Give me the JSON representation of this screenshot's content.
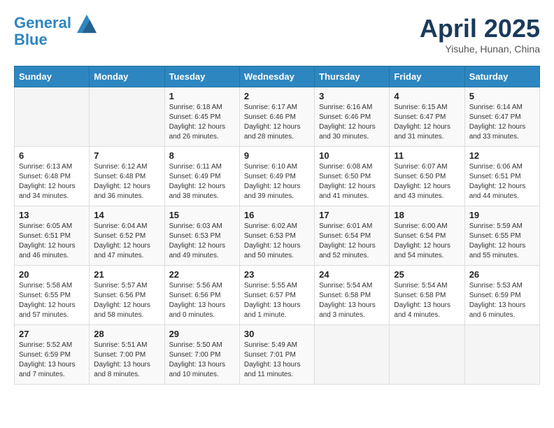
{
  "header": {
    "logo_line1": "General",
    "logo_line2": "Blue",
    "month": "April 2025",
    "location": "Yisuhe, Hunan, China"
  },
  "weekdays": [
    "Sunday",
    "Monday",
    "Tuesday",
    "Wednesday",
    "Thursday",
    "Friday",
    "Saturday"
  ],
  "weeks": [
    [
      {
        "day": "",
        "detail": ""
      },
      {
        "day": "",
        "detail": ""
      },
      {
        "day": "1",
        "detail": "Sunrise: 6:18 AM\nSunset: 6:45 PM\nDaylight: 12 hours and 26 minutes."
      },
      {
        "day": "2",
        "detail": "Sunrise: 6:17 AM\nSunset: 6:46 PM\nDaylight: 12 hours and 28 minutes."
      },
      {
        "day": "3",
        "detail": "Sunrise: 6:16 AM\nSunset: 6:46 PM\nDaylight: 12 hours and 30 minutes."
      },
      {
        "day": "4",
        "detail": "Sunrise: 6:15 AM\nSunset: 6:47 PM\nDaylight: 12 hours and 31 minutes."
      },
      {
        "day": "5",
        "detail": "Sunrise: 6:14 AM\nSunset: 6:47 PM\nDaylight: 12 hours and 33 minutes."
      }
    ],
    [
      {
        "day": "6",
        "detail": "Sunrise: 6:13 AM\nSunset: 6:48 PM\nDaylight: 12 hours and 34 minutes."
      },
      {
        "day": "7",
        "detail": "Sunrise: 6:12 AM\nSunset: 6:48 PM\nDaylight: 12 hours and 36 minutes."
      },
      {
        "day": "8",
        "detail": "Sunrise: 6:11 AM\nSunset: 6:49 PM\nDaylight: 12 hours and 38 minutes."
      },
      {
        "day": "9",
        "detail": "Sunrise: 6:10 AM\nSunset: 6:49 PM\nDaylight: 12 hours and 39 minutes."
      },
      {
        "day": "10",
        "detail": "Sunrise: 6:08 AM\nSunset: 6:50 PM\nDaylight: 12 hours and 41 minutes."
      },
      {
        "day": "11",
        "detail": "Sunrise: 6:07 AM\nSunset: 6:50 PM\nDaylight: 12 hours and 43 minutes."
      },
      {
        "day": "12",
        "detail": "Sunrise: 6:06 AM\nSunset: 6:51 PM\nDaylight: 12 hours and 44 minutes."
      }
    ],
    [
      {
        "day": "13",
        "detail": "Sunrise: 6:05 AM\nSunset: 6:51 PM\nDaylight: 12 hours and 46 minutes."
      },
      {
        "day": "14",
        "detail": "Sunrise: 6:04 AM\nSunset: 6:52 PM\nDaylight: 12 hours and 47 minutes."
      },
      {
        "day": "15",
        "detail": "Sunrise: 6:03 AM\nSunset: 6:53 PM\nDaylight: 12 hours and 49 minutes."
      },
      {
        "day": "16",
        "detail": "Sunrise: 6:02 AM\nSunset: 6:53 PM\nDaylight: 12 hours and 50 minutes."
      },
      {
        "day": "17",
        "detail": "Sunrise: 6:01 AM\nSunset: 6:54 PM\nDaylight: 12 hours and 52 minutes."
      },
      {
        "day": "18",
        "detail": "Sunrise: 6:00 AM\nSunset: 6:54 PM\nDaylight: 12 hours and 54 minutes."
      },
      {
        "day": "19",
        "detail": "Sunrise: 5:59 AM\nSunset: 6:55 PM\nDaylight: 12 hours and 55 minutes."
      }
    ],
    [
      {
        "day": "20",
        "detail": "Sunrise: 5:58 AM\nSunset: 6:55 PM\nDaylight: 12 hours and 57 minutes."
      },
      {
        "day": "21",
        "detail": "Sunrise: 5:57 AM\nSunset: 6:56 PM\nDaylight: 12 hours and 58 minutes."
      },
      {
        "day": "22",
        "detail": "Sunrise: 5:56 AM\nSunset: 6:56 PM\nDaylight: 13 hours and 0 minutes."
      },
      {
        "day": "23",
        "detail": "Sunrise: 5:55 AM\nSunset: 6:57 PM\nDaylight: 13 hours and 1 minute."
      },
      {
        "day": "24",
        "detail": "Sunrise: 5:54 AM\nSunset: 6:58 PM\nDaylight: 13 hours and 3 minutes."
      },
      {
        "day": "25",
        "detail": "Sunrise: 5:54 AM\nSunset: 6:58 PM\nDaylight: 13 hours and 4 minutes."
      },
      {
        "day": "26",
        "detail": "Sunrise: 5:53 AM\nSunset: 6:59 PM\nDaylight: 13 hours and 6 minutes."
      }
    ],
    [
      {
        "day": "27",
        "detail": "Sunrise: 5:52 AM\nSunset: 6:59 PM\nDaylight: 13 hours and 7 minutes."
      },
      {
        "day": "28",
        "detail": "Sunrise: 5:51 AM\nSunset: 7:00 PM\nDaylight: 13 hours and 8 minutes."
      },
      {
        "day": "29",
        "detail": "Sunrise: 5:50 AM\nSunset: 7:00 PM\nDaylight: 13 hours and 10 minutes."
      },
      {
        "day": "30",
        "detail": "Sunrise: 5:49 AM\nSunset: 7:01 PM\nDaylight: 13 hours and 11 minutes."
      },
      {
        "day": "",
        "detail": ""
      },
      {
        "day": "",
        "detail": ""
      },
      {
        "day": "",
        "detail": ""
      }
    ]
  ]
}
